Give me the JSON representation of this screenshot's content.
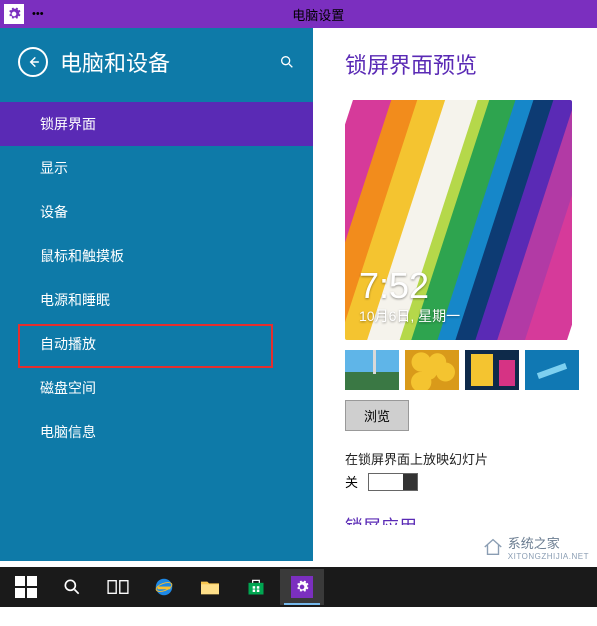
{
  "title_bar": {
    "app_title": "电脑设置",
    "dots": "•••"
  },
  "sidebar": {
    "title": "电脑和设备",
    "items": [
      {
        "label": "锁屏界面",
        "selected": true
      },
      {
        "label": "显示",
        "selected": false
      },
      {
        "label": "设备",
        "selected": false
      },
      {
        "label": "鼠标和触摸板",
        "selected": false
      },
      {
        "label": "电源和睡眠",
        "selected": false
      },
      {
        "label": "自动播放",
        "selected": false,
        "highlighted": true
      },
      {
        "label": "磁盘空间",
        "selected": false
      },
      {
        "label": "电脑信息",
        "selected": false
      }
    ]
  },
  "content": {
    "title": "锁屏界面预览",
    "clock_time": "7:52",
    "clock_date": "10月6日, 星期一",
    "browse_label": "浏览",
    "slideshow_label": "在锁屏界面上放映幻灯片",
    "toggle_state": "关",
    "bottom_heading_partial": "锁屏应用"
  },
  "watermark": {
    "text_top": "系统之家",
    "text_bottom": "XITONGZHIJIA.NET"
  }
}
